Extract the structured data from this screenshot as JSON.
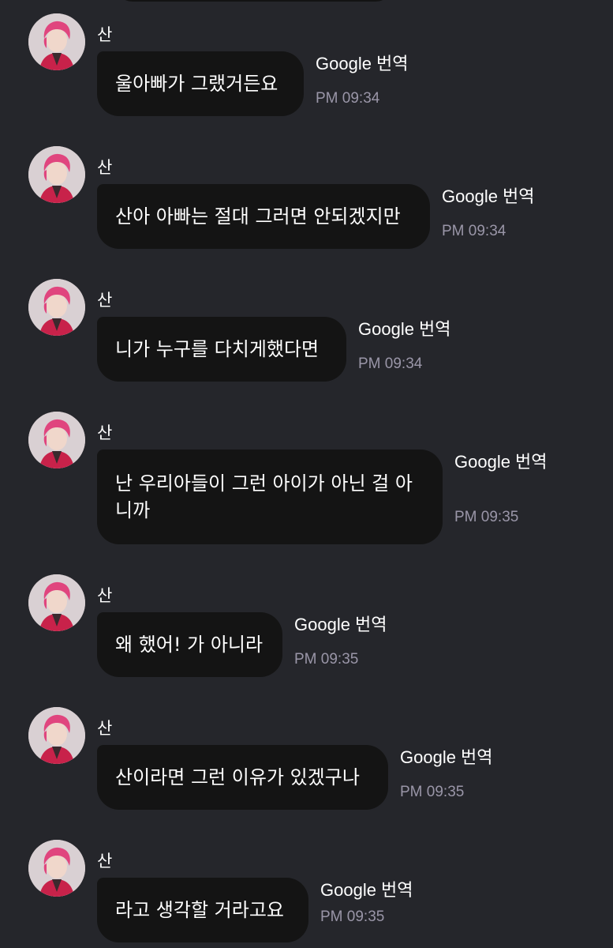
{
  "chat": {
    "messages": [
      {
        "sender": "산",
        "text": "울아빠가 그랬거든요",
        "translate": "Google 번역",
        "time": "PM 09:34"
      },
      {
        "sender": "산",
        "text": "산아 아빠는 절대 그러면 안되겠지만",
        "translate": "Google 번역",
        "time": "PM 09:34"
      },
      {
        "sender": "산",
        "text": "니가 누구를 다치게했다면",
        "translate": "Google 번역",
        "time": "PM 09:34"
      },
      {
        "sender": "산",
        "text": "난 우리아들이 그런 아이가 아닌 걸 아니까",
        "translate": "Google 번역",
        "time": "PM 09:35"
      },
      {
        "sender": "산",
        "text": "왜 했어! 가 아니라",
        "translate": "Google 번역",
        "time": "PM 09:35"
      },
      {
        "sender": "산",
        "text": "산이라면 그런 이유가 있겠구나",
        "translate": "Google 번역",
        "time": "PM 09:35"
      },
      {
        "sender": "산",
        "text": "라고 생각할 거라고요",
        "translate": "Google 번역",
        "time": "PM 09:35"
      }
    ]
  },
  "colors": {
    "background": "#25262b",
    "bubble": "#141414",
    "text": "#ffffff",
    "timestamp": "#9a96a8",
    "avatar_hair": "#e0457e",
    "avatar_jacket": "#c8224a"
  }
}
